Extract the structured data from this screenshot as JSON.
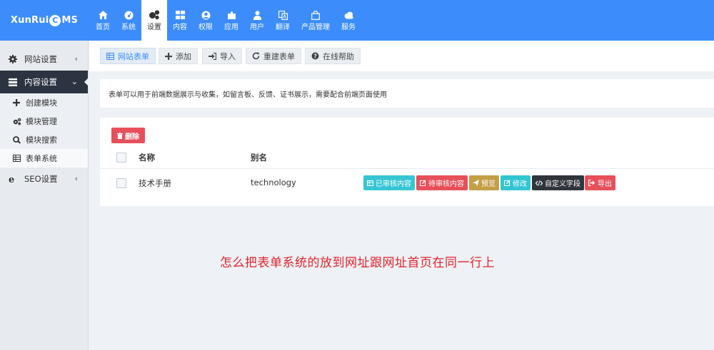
{
  "app": {
    "logo_text_left": "XunRui",
    "logo_mark": "C",
    "logo_text_right": "MS"
  },
  "nav": {
    "items": [
      {
        "label": "首页",
        "icon": "home-icon"
      },
      {
        "label": "系统",
        "icon": "dashboard-icon"
      },
      {
        "label": "设置",
        "icon": "gears-icon",
        "active": true
      },
      {
        "label": "内容",
        "icon": "grid-icon"
      },
      {
        "label": "权限",
        "icon": "user-circle-icon"
      },
      {
        "label": "应用",
        "icon": "puzzle-icon"
      },
      {
        "label": "用户",
        "icon": "user-icon"
      },
      {
        "label": "翻译",
        "icon": "translate-icon"
      },
      {
        "label": "产品管理",
        "icon": "bag-icon"
      },
      {
        "label": "服务",
        "icon": "cloud-icon"
      }
    ]
  },
  "sidebar": {
    "groups": [
      {
        "label": "网站设置",
        "icon": "gear-icon",
        "caret": "‹",
        "open": false
      },
      {
        "label": "内容设置",
        "icon": "bars-icon",
        "caret": "⌄",
        "open": true
      },
      {
        "label": "SEO设置",
        "icon": "ie-icon",
        "caret": "‹",
        "open": false
      }
    ],
    "sub_items": [
      {
        "label": "创建模块",
        "icon": "plus-icon"
      },
      {
        "label": "模块管理",
        "icon": "gears-icon"
      },
      {
        "label": "模块搜索",
        "icon": "search-icon"
      },
      {
        "label": "表单系统",
        "icon": "table-icon",
        "active": true
      }
    ]
  },
  "toolbar": {
    "buttons": [
      {
        "label": "网站表单",
        "icon": "table-icon"
      },
      {
        "label": "添加",
        "icon": "plus-icon"
      },
      {
        "label": "导入",
        "icon": "sign-in-icon"
      },
      {
        "label": "重建表单",
        "icon": "refresh-icon"
      },
      {
        "label": "在线帮助",
        "icon": "question-circle-icon"
      }
    ]
  },
  "notice": {
    "text": "表单可以用于前端数据展示与收集，如留言板、反馈、证书展示，需要配合前端页面使用"
  },
  "table": {
    "delete_label": "删除",
    "headers": {
      "name": "名称",
      "alias": "别名"
    },
    "rows": [
      {
        "name": "技术手册",
        "alias": "technology",
        "actions": [
          {
            "label": "已审核内容",
            "icon": "table-icon",
            "color": "#36c6d3"
          },
          {
            "label": "待审核内容",
            "icon": "edit-icon",
            "color": "#e7505a"
          },
          {
            "label": "预览",
            "icon": "send-icon",
            "color": "#c49f47"
          },
          {
            "label": "修改",
            "icon": "edit-icon",
            "color": "#32c5d2"
          },
          {
            "label": "自定义字段",
            "icon": "code-icon",
            "color": "#2f353b"
          },
          {
            "label": "导出",
            "icon": "sign-out-icon",
            "color": "#e7505a"
          }
        ]
      }
    ]
  },
  "annotation": {
    "text": "怎么把表单系统的放到网址跟网址首页在同一行上",
    "color": "#e0242b"
  },
  "colors": {
    "topbar": "#3c8dfb",
    "sidebar_open": "#2c3441",
    "danger": "#e7505a"
  }
}
